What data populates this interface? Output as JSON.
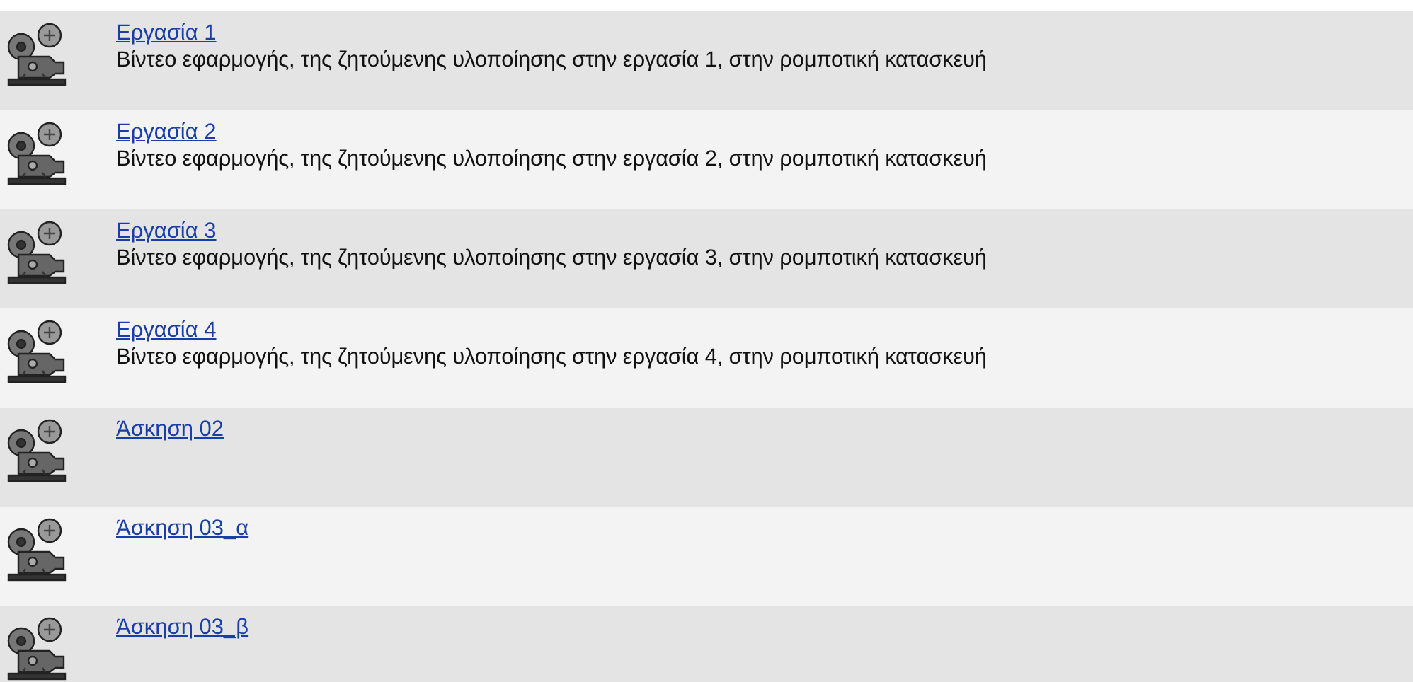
{
  "items": [
    {
      "title": "Εργασία 1",
      "description": "Βίντεο εφαρμογής, της ζητούμενης υλοποίησης στην εργασία 1, στην ρομποτική κατασκευή"
    },
    {
      "title": "Εργασία 2",
      "description": "Βίντεο εφαρμογής, της ζητούμενης υλοποίησης στην εργασία 2, στην ρομποτική κατασκευή"
    },
    {
      "title": "Εργασία 3",
      "description": "Βίντεο εφαρμογής, της ζητούμενης υλοποίησης στην εργασία 3, στην ρομποτική κατασκευή"
    },
    {
      "title": "Εργασία 4",
      "description": "Βίντεο εφαρμογής, της ζητούμενης υλοποίησης στην εργασία 4, στην ρομποτική κατασκευή"
    },
    {
      "title": "Άσκηση 02"
    },
    {
      "title": "Άσκηση 03_α"
    },
    {
      "title": "Άσκηση 03_β"
    }
  ]
}
